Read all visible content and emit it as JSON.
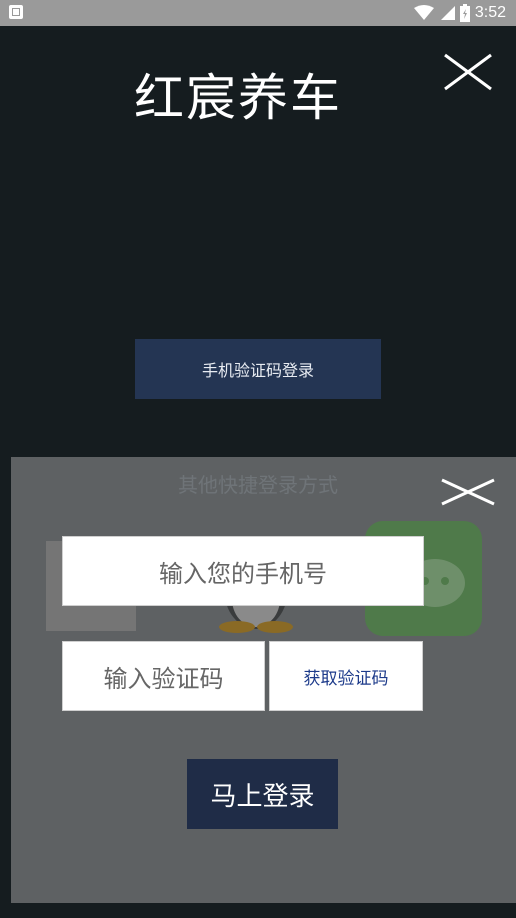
{
  "status_bar": {
    "time": "3:52",
    "icons": [
      "app-notification-icon",
      "wifi-icon",
      "signal-icon",
      "battery-icon"
    ]
  },
  "main": {
    "title": "红宸养车",
    "close_icon": "close-icon",
    "sms_login_label": "手机验证码登录"
  },
  "quick_login": {
    "title": "其他快捷登录方式",
    "close_icon": "close-icon",
    "options": [
      "account-login-icon",
      "qq-icon",
      "wechat-icon"
    ]
  },
  "login_form": {
    "phone_placeholder": "输入您的手机号",
    "code_placeholder": "输入验证码",
    "get_code_label": "获取验证码",
    "submit_label": "马上登录"
  },
  "colors": {
    "background": "#151c1f",
    "primary_button": "#243553",
    "submit_button": "#1f2c47",
    "link_text": "#1c3a8a"
  }
}
